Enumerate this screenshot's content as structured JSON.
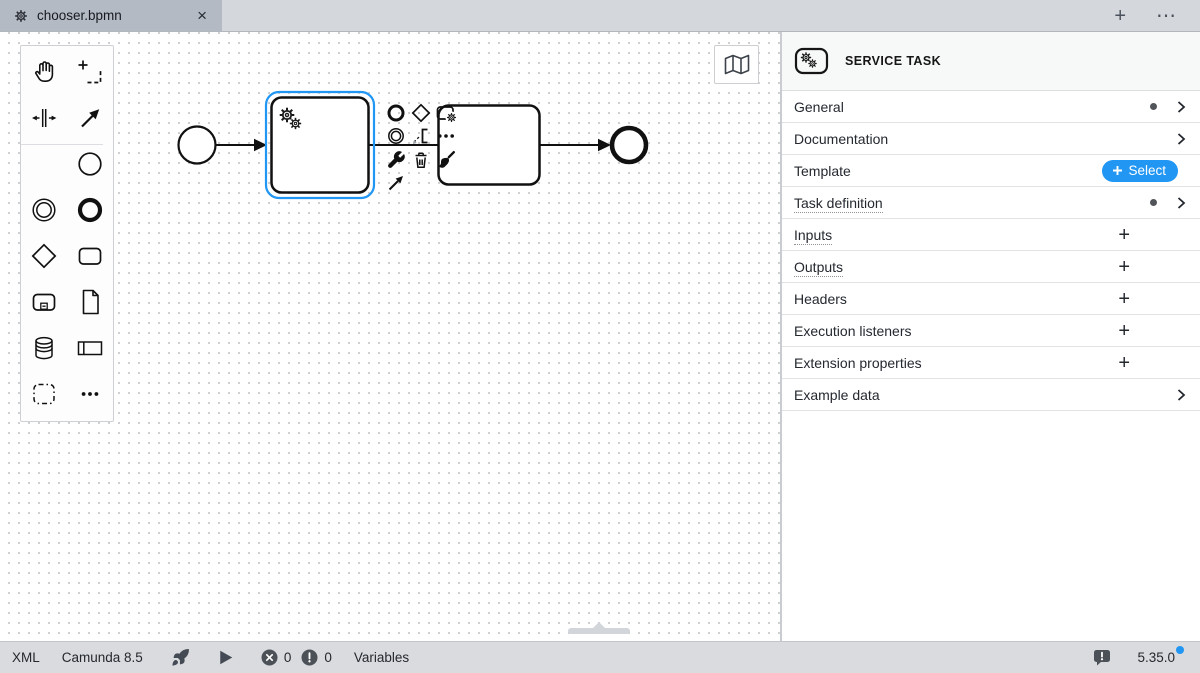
{
  "colors": {
    "accent_blue": "#2196f3",
    "selection_outline": "#2196f3",
    "tab_bar_bg": "#d4d7dc",
    "active_tab_bg": "#b4bac4",
    "status_bar_bg": "#d9dbde",
    "panel_header_bg": "#f7f8f8"
  },
  "tab_bar": {
    "active_tab_title": "chooser.bpmn",
    "close_label": "×",
    "new_tab_label": "+",
    "overflow_label": "⋯"
  },
  "palette": {
    "tools": [
      "hand-tool",
      "lasso-tool",
      "space-tool",
      "global-connect-tool"
    ],
    "elements": [
      "create-start-event",
      "create-intermediate-event",
      "create-end-event",
      "create-gateway",
      "create-task",
      "create-subprocess",
      "create-data-object",
      "create-data-store",
      "create-participant",
      "create-group"
    ],
    "more": "show-more-entries"
  },
  "canvas": {
    "selected_element_type": "service-task",
    "elements": [
      {
        "type": "start-event"
      },
      {
        "type": "service-task",
        "selected": true
      },
      {
        "type": "task"
      },
      {
        "type": "end-event"
      }
    ],
    "context_pad_actions": [
      "append-end-event",
      "append-gateway",
      "append-task",
      "append-intermediate-event",
      "append-text-annotation",
      "more-append-options",
      "change-element",
      "delete",
      "set-color",
      "connect"
    ],
    "minimap_toggle": "map-icon"
  },
  "properties_panel": {
    "title": "SERVICE TASK",
    "groups": [
      {
        "label": "General",
        "configured": true,
        "expandable": true
      },
      {
        "label": "Documentation",
        "expandable": true
      },
      {
        "label": "Template",
        "action_label": "Select"
      },
      {
        "label": "Task definition",
        "configured": true,
        "expandable": true
      },
      {
        "label": "Inputs",
        "action_label": "+"
      },
      {
        "label": "Outputs",
        "action_label": "+"
      },
      {
        "label": "Headers",
        "action_label": "+"
      },
      {
        "label": "Execution listeners",
        "action_label": "+"
      },
      {
        "label": "Extension properties",
        "action_label": "+"
      },
      {
        "label": "Example data",
        "expandable": true
      }
    ]
  },
  "status_bar": {
    "xml_label": "XML",
    "engine_label": "Camunda 8.5",
    "error_count": "0",
    "warning_count": "0",
    "variables_label": "Variables",
    "version": "5.35.0"
  }
}
